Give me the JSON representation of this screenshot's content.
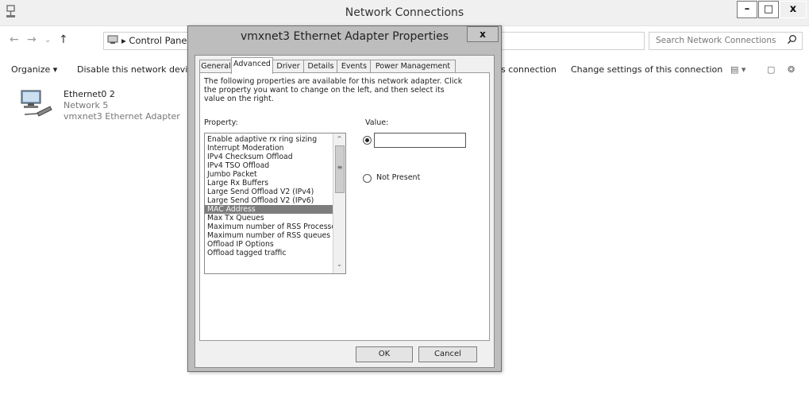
{
  "window": {
    "title": "Network Connections",
    "caption_buttons": {
      "minimize": "–",
      "maximize": "□",
      "close": "x"
    }
  },
  "address": {
    "crumb": "▸ Control Panel ▸",
    "dropdown_glyph": "⌄",
    "refresh_glyph": "↻",
    "search_placeholder": "Search Network Connections",
    "search_icon": "search-icon"
  },
  "nav": {
    "back": "←",
    "forward": "→",
    "down": "⌄",
    "up": "↑"
  },
  "commandbar": {
    "organize": "Organize ▾",
    "disable": "Disable this network devic",
    "rename_partial": "s connection",
    "change_settings": "Change settings of this connection",
    "view_glyph": "▤ ▾",
    "pane_glyph": "▢",
    "help_glyph": "❂"
  },
  "connection": {
    "name": "Ethernet0 2",
    "network": "Network  5",
    "adapter": "vmxnet3 Ethernet Adapter"
  },
  "dialog": {
    "title": "vmxnet3 Ethernet Adapter Properties",
    "close_glyph": "x",
    "tabs": [
      "General",
      "Advanced",
      "Driver",
      "Details",
      "Events",
      "Power Management"
    ],
    "active_tab": "Advanced",
    "description": "The following properties are available for this network adapter. Click the property you want to change on the left, and then select its value on the right.",
    "property_label": "Property:",
    "value_label": "Value:",
    "properties": [
      "Enable adaptive rx ring sizing",
      "Interrupt Moderation",
      "IPv4 Checksum Offload",
      "IPv4 TSO Offload",
      "Jumbo Packet",
      "Large Rx Buffers",
      "Large Send Offload V2 (IPv4)",
      "Large Send Offload V2 (IPv6)",
      "MAC Address",
      "Max Tx Queues",
      "Maximum number of RSS Processo",
      "Maximum number of RSS queues",
      "Offload IP Options",
      "Offload tagged traffic"
    ],
    "selected_property": "MAC Address",
    "value": "",
    "not_present_label": "Not Present",
    "scroll_up_glyph": "^",
    "scroll_grip_glyph": "≡",
    "scroll_down_glyph": "⌄",
    "ok_label": "OK",
    "cancel_label": "Cancel"
  }
}
